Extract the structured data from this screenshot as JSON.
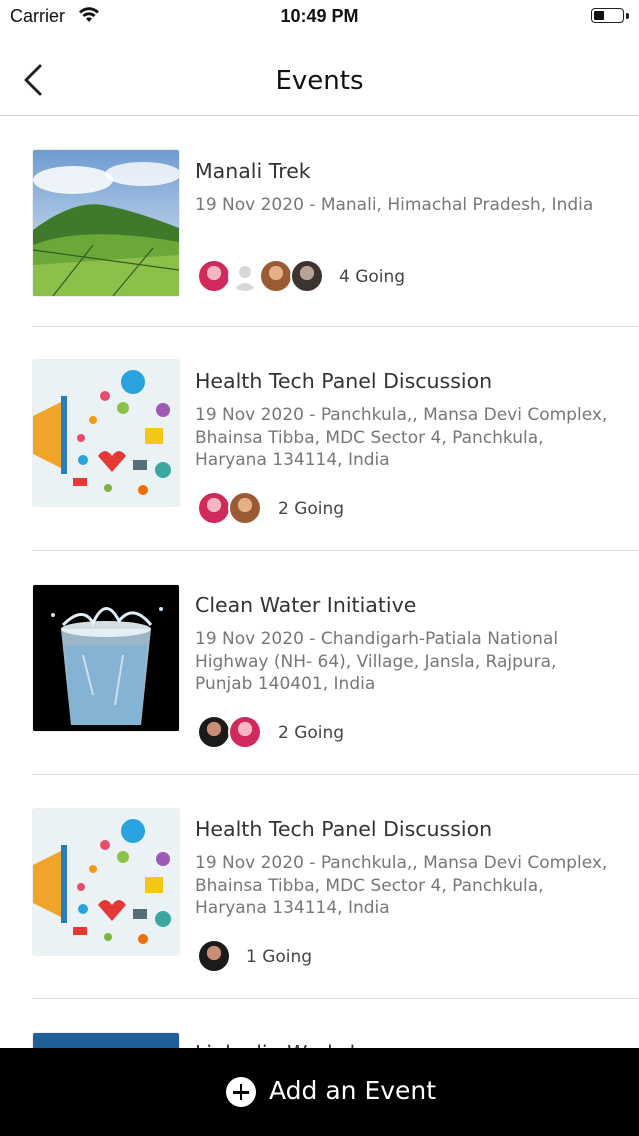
{
  "status_bar": {
    "carrier": "Carrier",
    "time": "10:49 PM"
  },
  "header": {
    "title": "Events"
  },
  "events": [
    {
      "title": "Manali Trek",
      "subtitle": "19 Nov 2020 - Manali, Himachal Pradesh, India",
      "going": "4 Going",
      "image": "mountain-landscape"
    },
    {
      "title": "Health Tech Panel Discussion",
      "subtitle": "19 Nov 2020 - Panchkula,, Mansa Devi Complex, Bhainsa Tibba, MDC Sector 4, Panchkula, Haryana 134114, India",
      "going": "2 Going",
      "image": "megaphone-social-icons"
    },
    {
      "title": "Clean Water Initiative",
      "subtitle": "19 Nov 2020 - Chandigarh-Patiala National Highway (NH- 64), Village, Jansla, Rajpura, Punjab 140401, India",
      "going": "2 Going",
      "image": "water-glass-splash"
    },
    {
      "title": "Health Tech Panel Discussion",
      "subtitle": "19 Nov 2020 - Panchkula,, Mansa Devi Complex, Bhainsa Tibba, MDC Sector 4, Panchkula, Haryana 134114, India",
      "going": "1 Going",
      "image": "megaphone-social-icons"
    }
  ],
  "partial_event": {
    "title": "Linkedin Workshop"
  },
  "bottom_bar": {
    "add_label": "Add an Event"
  }
}
